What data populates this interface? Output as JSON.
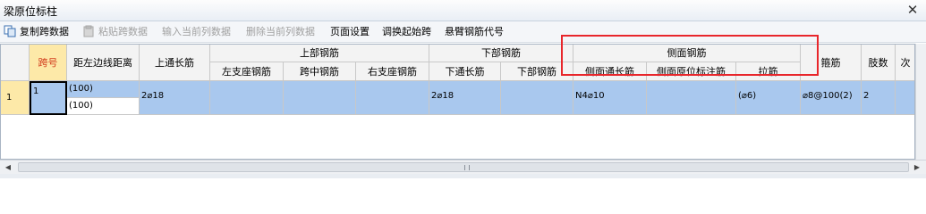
{
  "window": {
    "title": "梁原位标柱",
    "close_glyph": "✕"
  },
  "toolbar": {
    "copy_span_data": "复制跨数据",
    "paste_span_data": "粘贴跨数据",
    "input_current_column": "输入当前列数据",
    "delete_current_column": "删除当前列数据",
    "page_settings": "页面设置",
    "adjust_start_span": "调换起始跨",
    "cantilever_rebar_code": "悬臂钢筋代号"
  },
  "table": {
    "headers": {
      "span_no": "跨号",
      "dist_left_edge": "距左边线距离",
      "top_through_rebar": "上通长筋",
      "top_rebar_group": "上部钢筋",
      "left_support_rebar": "左支座钢筋",
      "mid_span_rebar": "跨中钢筋",
      "right_support_rebar": "右支座钢筋",
      "bottom_rebar_group": "下部钢筋",
      "bottom_through_rebar": "下通长筋",
      "bottom_rebar": "下部钢筋",
      "side_rebar_group": "侧面钢筋",
      "side_through_rebar": "侧面通长筋",
      "side_in_situ_rebar": "侧面原位标注筋",
      "tie_bar": "拉筋",
      "stirrup": "箍筋",
      "legs": "肢数",
      "next": "次"
    },
    "rows": [
      {
        "row_no": "1",
        "span_no": "1",
        "dist_1": "(100)",
        "dist_2": "(100)",
        "top_through_rebar": "2⌀18",
        "left_support_rebar": "",
        "mid_span_rebar": "",
        "right_support_rebar": "",
        "bottom_through_rebar": "2⌀18",
        "bottom_rebar": "",
        "side_through_rebar": "N4⌀10",
        "side_in_situ_rebar": "",
        "tie_bar": "(⌀6)",
        "stirrup": "⌀8@100(2)",
        "legs": "2"
      }
    ]
  },
  "scrollbar": {
    "left_arrow": "◀",
    "right_arrow": "▶"
  },
  "colors": {
    "highlight_box": "#e8262b",
    "selected_row": "#a9c8ee",
    "header_highlight": "#fde9a8"
  }
}
